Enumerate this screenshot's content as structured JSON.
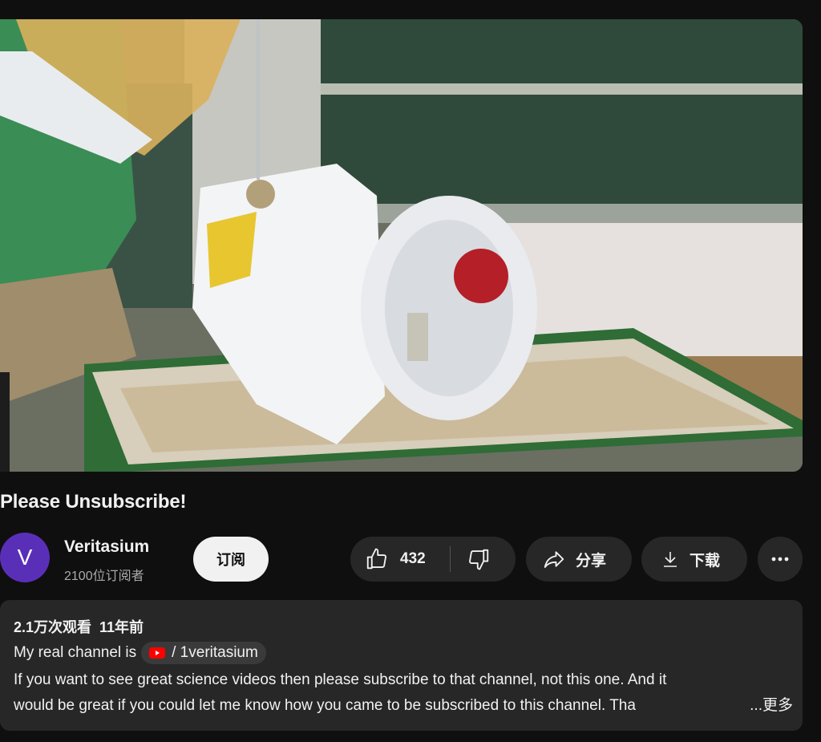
{
  "video": {
    "title": "Please Unsubscribe!"
  },
  "channel": {
    "avatar_letter": "V",
    "name": "Veritasium",
    "subscribers": "2100位订阅者"
  },
  "actions": {
    "subscribe_label": "订阅",
    "like_count": "432",
    "share_label": "分享",
    "download_label": "下载"
  },
  "description": {
    "views": "2.1万次观看",
    "age": "11年前",
    "line_prefix": "My real channel is",
    "channel_link": "/ 1veritasium",
    "line1": "If you want to see great science videos then please subscribe to that channel, not this one. And it",
    "line2": "would be great if you could let me know how you came to be subscribed to this channel. Tha",
    "more_label": "...更多"
  },
  "icons": {
    "like": "thumbs-up-icon",
    "dislike": "thumbs-down-icon",
    "share": "share-arrow-icon",
    "download": "download-icon",
    "more": "more-horizontal-icon",
    "youtube": "youtube-logo-icon"
  },
  "colors": {
    "background": "#0f0f0f",
    "surface": "#272727",
    "avatar": "#5a2fb8",
    "text": "#f1f1f1",
    "muted": "#aaaaaa",
    "youtube_red": "#ff0000"
  }
}
